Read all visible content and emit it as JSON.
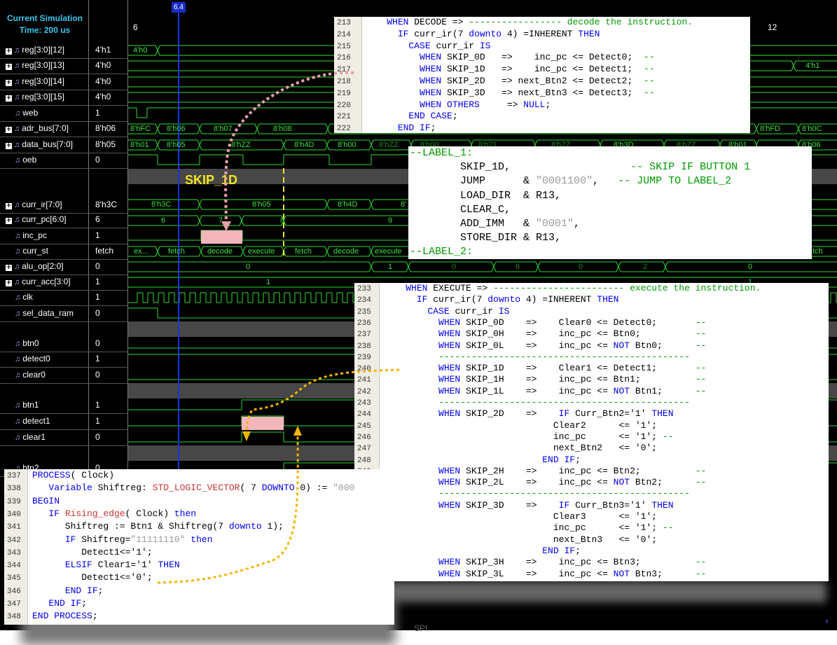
{
  "simulator": {
    "title_line1": "Current Simulation",
    "title_line2": "Time: 200 us",
    "cursor_time": "6.4",
    "ticks": [
      "6",
      "12"
    ],
    "annotation": "SKIP_1D",
    "bottom_text": "SPI"
  },
  "signals": [
    {
      "name": "reg[3:0][12]",
      "value": "4'h1"
    },
    {
      "name": "reg[3:0][13]",
      "value": "4'h0"
    },
    {
      "name": "reg[3:0][14]",
      "value": "4'h0"
    },
    {
      "name": "reg[3:0][15]",
      "value": "4'h0"
    },
    {
      "name": "web",
      "value": "1"
    },
    {
      "name": "adr_bus[7:0]",
      "value": "8'h06"
    },
    {
      "name": "data_bus[7:0]",
      "value": "8'h05"
    },
    {
      "name": "oeb",
      "value": "0"
    },
    {
      "name": "curr_ir[7:0]",
      "value": "8'h3C"
    },
    {
      "name": "curr_pc[6:0]",
      "value": "6"
    },
    {
      "name": "inc_pc",
      "value": "1"
    },
    {
      "name": "curr_st",
      "value": "fetch"
    },
    {
      "name": "alu_op[2:0]",
      "value": "0"
    },
    {
      "name": "curr_acc[3:0]",
      "value": "1"
    },
    {
      "name": "clk",
      "value": "1"
    },
    {
      "name": "sel_data_ram",
      "value": "0"
    },
    {
      "name": "btn0",
      "value": "0"
    },
    {
      "name": "detect0",
      "value": "1"
    },
    {
      "name": "clear0",
      "value": "0"
    },
    {
      "name": "btn1",
      "value": "1"
    },
    {
      "name": "detect1",
      "value": "1"
    },
    {
      "name": "clear1",
      "value": "0"
    },
    {
      "name": "btn2",
      "value": "0"
    }
  ],
  "wave_labels": {
    "reg12": [
      "4'h0"
    ],
    "reg13": [
      "4'h1"
    ],
    "adr": [
      "8'hFC",
      "8'h06",
      "8'h07",
      "8'h08",
      "8'hFD",
      "8'h0C"
    ],
    "data": [
      "8'h01",
      "8'h05",
      "8'hZZ",
      "8'h4D",
      "8'h00",
      "8'hZZ",
      "8'h00",
      "8'h21",
      "8'hZZ",
      "8'h3D",
      "8'hZZ",
      "8'h01",
      "8'h06"
    ],
    "ir": [
      "8'h3C",
      "8'h05",
      "8'h4D",
      "8'"
    ],
    "pc": [
      "6",
      "7",
      "8",
      "9"
    ],
    "st": [
      "ex...",
      "fetch",
      "decode",
      "execute",
      "fetch",
      "decode",
      "execute",
      "tch"
    ],
    "alu": [
      "0",
      "1",
      "0",
      "6",
      "0",
      "2",
      "0"
    ],
    "acc": [
      "1",
      "1"
    ]
  },
  "decode_panel": {
    "lines": [
      {
        "n": "213",
        "segs": [
          {
            "t": "    "
          },
          {
            "t": "WHEN",
            "c": "kw"
          },
          {
            "t": " DECODE => "
          },
          {
            "t": "----------------- decode the instruction.",
            "c": "cm"
          }
        ]
      },
      {
        "n": "214",
        "segs": [
          {
            "t": "      "
          },
          {
            "t": "IF",
            "c": "kw"
          },
          {
            "t": " curr_ir(7 "
          },
          {
            "t": "downto",
            "c": "kw"
          },
          {
            "t": " 4) =INHERENT "
          },
          {
            "t": "THEN",
            "c": "kw"
          }
        ]
      },
      {
        "n": "215",
        "segs": [
          {
            "t": "        "
          },
          {
            "t": "CASE",
            "c": "kw"
          },
          {
            "t": " curr_ir "
          },
          {
            "t": "IS",
            "c": "kw"
          }
        ]
      },
      {
        "n": "216",
        "segs": [
          {
            "t": "          "
          },
          {
            "t": "WHEN",
            "c": "kw"
          },
          {
            "t": " SKIP_0D   =>    inc_pc <= Detect0;  "
          },
          {
            "t": "--",
            "c": "cm"
          }
        ]
      },
      {
        "n": "217",
        "segs": [
          {
            "t": "          "
          },
          {
            "t": "WHEN",
            "c": "kw"
          },
          {
            "t": " SKIP_1D   =>    inc_pc <= Detect1;  "
          },
          {
            "t": "--",
            "c": "cm"
          }
        ]
      },
      {
        "n": "218",
        "segs": [
          {
            "t": "          "
          },
          {
            "t": "WHEN",
            "c": "kw"
          },
          {
            "t": " SKIP_2D   => next_Btn2 <= Detect2;  "
          },
          {
            "t": "--",
            "c": "cm"
          }
        ]
      },
      {
        "n": "219",
        "segs": [
          {
            "t": "          "
          },
          {
            "t": "WHEN",
            "c": "kw"
          },
          {
            "t": " SKIP_3D   => next_Btn3 <= Detect3;  "
          },
          {
            "t": "--",
            "c": "cm"
          }
        ]
      },
      {
        "n": "220",
        "segs": [
          {
            "t": "          "
          },
          {
            "t": "WHEN",
            "c": "kw"
          },
          {
            "t": " "
          },
          {
            "t": "OTHERS",
            "c": "kw"
          },
          {
            "t": "     => "
          },
          {
            "t": "NULL",
            "c": "kw"
          },
          {
            "t": ";"
          }
        ]
      },
      {
        "n": "221",
        "segs": [
          {
            "t": "        "
          },
          {
            "t": "END CASE",
            "c": "kw"
          },
          {
            "t": ";"
          }
        ]
      },
      {
        "n": "222",
        "segs": [
          {
            "t": "      "
          },
          {
            "t": "END IF",
            "c": "kw"
          },
          {
            "t": ";"
          }
        ]
      }
    ]
  },
  "label_panel": {
    "lines": [
      {
        "segs": [
          {
            "t": "--LABEL_1:",
            "c": "cm"
          }
        ]
      },
      {
        "segs": [
          {
            "t": "        SKIP_1D,                   "
          },
          {
            "t": "-- SKIP IF BUTTON 1",
            "c": "cm"
          }
        ]
      },
      {
        "segs": [
          {
            "t": "        JUMP      & "
          },
          {
            "t": "\"0001100\"",
            "c": "st"
          },
          {
            "t": ",   "
          },
          {
            "t": "-- JUMP TO LABEL_2",
            "c": "cm"
          }
        ]
      },
      {
        "segs": [
          {
            "t": "        LOAD_DIR  & R13,"
          }
        ]
      },
      {
        "segs": [
          {
            "t": "        CLEAR_C,"
          }
        ]
      },
      {
        "segs": [
          {
            "t": "        ADD_IMM   & "
          },
          {
            "t": "\"0001\"",
            "c": "st"
          },
          {
            "t": ","
          }
        ]
      },
      {
        "segs": [
          {
            "t": "        STORE_DIR & R13,"
          }
        ]
      },
      {
        "segs": [
          {
            "t": "--LABEL_2:",
            "c": "cm"
          }
        ]
      }
    ]
  },
  "execute_panel": {
    "lines": [
      {
        "n": "233",
        "segs": [
          {
            "t": "    "
          },
          {
            "t": "WHEN",
            "c": "kw"
          },
          {
            "t": " EXECUTE => "
          },
          {
            "t": "------------------------ execute the instruction.",
            "c": "cm"
          }
        ]
      },
      {
        "n": "234",
        "segs": [
          {
            "t": "      "
          },
          {
            "t": "IF",
            "c": "kw"
          },
          {
            "t": " curr_ir(7 "
          },
          {
            "t": "downto",
            "c": "kw"
          },
          {
            "t": " 4) =INHERENT "
          },
          {
            "t": "THEN",
            "c": "kw"
          }
        ]
      },
      {
        "n": "235",
        "segs": [
          {
            "t": "        "
          },
          {
            "t": "CASE",
            "c": "kw"
          },
          {
            "t": " curr_ir "
          },
          {
            "t": "IS",
            "c": "kw"
          }
        ]
      },
      {
        "n": "236",
        "segs": [
          {
            "t": "          "
          },
          {
            "t": "WHEN",
            "c": "kw"
          },
          {
            "t": " SKIP_0D    =>    Clear0 <= Detect0;       "
          },
          {
            "t": "--",
            "c": "cm"
          }
        ]
      },
      {
        "n": "237",
        "segs": [
          {
            "t": "          "
          },
          {
            "t": "WHEN",
            "c": "kw"
          },
          {
            "t": " SKIP_0H    =>    inc_pc <= Btn0;          "
          },
          {
            "t": "--",
            "c": "cm"
          }
        ]
      },
      {
        "n": "238",
        "segs": [
          {
            "t": "          "
          },
          {
            "t": "WHEN",
            "c": "kw"
          },
          {
            "t": " SKIP_0L    =>    inc_pc <= "
          },
          {
            "t": "NOT",
            "c": "kw"
          },
          {
            "t": " Btn0;      "
          },
          {
            "t": "--",
            "c": "cm"
          }
        ]
      },
      {
        "n": "239",
        "segs": [
          {
            "t": "          "
          },
          {
            "t": "----------------------------------------------",
            "c": "cm"
          }
        ]
      },
      {
        "n": "240",
        "segs": [
          {
            "t": "          "
          },
          {
            "t": "WHEN",
            "c": "kw"
          },
          {
            "t": " SKIP_1D    =>    Clear1 <= Detect1;       "
          },
          {
            "t": "--",
            "c": "cm"
          }
        ]
      },
      {
        "n": "241",
        "segs": [
          {
            "t": "          "
          },
          {
            "t": "WHEN",
            "c": "kw"
          },
          {
            "t": " SKIP_1H    =>    inc_pc <= Btn1;          "
          },
          {
            "t": "--",
            "c": "cm"
          }
        ]
      },
      {
        "n": "242",
        "segs": [
          {
            "t": "          "
          },
          {
            "t": "WHEN",
            "c": "kw"
          },
          {
            "t": " SKIP_1L    =>    inc_pc <= "
          },
          {
            "t": "NOT",
            "c": "kw"
          },
          {
            "t": " Btn1;      "
          },
          {
            "t": "--",
            "c": "cm"
          }
        ]
      },
      {
        "n": "243",
        "segs": [
          {
            "t": "          "
          },
          {
            "t": "----------------------------------------------",
            "c": "cm"
          }
        ]
      },
      {
        "n": "244",
        "segs": [
          {
            "t": "          "
          },
          {
            "t": "WHEN",
            "c": "kw"
          },
          {
            "t": " SKIP_2D    =>    "
          },
          {
            "t": "IF",
            "c": "kw"
          },
          {
            "t": " Curr_Btn2='1' "
          },
          {
            "t": "THEN",
            "c": "kw"
          }
        ]
      },
      {
        "n": "245",
        "segs": [
          {
            "t": "                               Clear2      <= '1';"
          }
        ]
      },
      {
        "n": "246",
        "segs": [
          {
            "t": "                               inc_pc      <= '1'; "
          },
          {
            "t": "--",
            "c": "cm"
          }
        ]
      },
      {
        "n": "247",
        "segs": [
          {
            "t": "                               next_Btn2   <= '0';"
          }
        ]
      },
      {
        "n": "248",
        "segs": [
          {
            "t": "                             "
          },
          {
            "t": "END IF",
            "c": "kw"
          },
          {
            "t": ";"
          }
        ]
      },
      {
        "n": "249",
        "segs": [
          {
            "t": "          "
          },
          {
            "t": "WHEN",
            "c": "kw"
          },
          {
            "t": " SKIP_2H    =>    inc_pc <= Btn2;          "
          },
          {
            "t": "--",
            "c": "cm"
          }
        ]
      },
      {
        "n": "250",
        "segs": [
          {
            "t": "          "
          },
          {
            "t": "WHEN",
            "c": "kw"
          },
          {
            "t": " SKIP_2L    =>    inc_pc <= "
          },
          {
            "t": "NOT",
            "c": "kw"
          },
          {
            "t": " Btn2;      "
          },
          {
            "t": "--",
            "c": "cm"
          }
        ]
      },
      {
        "n": "251",
        "segs": [
          {
            "t": "          "
          },
          {
            "t": "----------------------------------------------",
            "c": "cm"
          }
        ]
      },
      {
        "n": "252",
        "segs": [
          {
            "t": "          "
          },
          {
            "t": "WHEN",
            "c": "kw"
          },
          {
            "t": " SKIP_3D    =>    "
          },
          {
            "t": "IF",
            "c": "kw"
          },
          {
            "t": " Curr_Btn3='1' "
          },
          {
            "t": "THEN",
            "c": "kw"
          }
        ]
      },
      {
        "n": "253",
        "segs": [
          {
            "t": "                               Clear3      <= '1';"
          }
        ]
      },
      {
        "n": "254",
        "segs": [
          {
            "t": "                               inc_pc      <= '1'; "
          },
          {
            "t": "--",
            "c": "cm"
          }
        ]
      },
      {
        "n": "255",
        "segs": [
          {
            "t": "                               next_Btn3   <= '0';"
          }
        ]
      },
      {
        "n": "256",
        "segs": [
          {
            "t": "                             "
          },
          {
            "t": "END IF",
            "c": "kw"
          },
          {
            "t": ";"
          }
        ]
      },
      {
        "n": "257",
        "segs": [
          {
            "t": "          "
          },
          {
            "t": "WHEN",
            "c": "kw"
          },
          {
            "t": " SKIP_3H    =>    inc_pc <= Btn3;          "
          },
          {
            "t": "--",
            "c": "cm"
          }
        ]
      },
      {
        "n": "258",
        "segs": [
          {
            "t": "          "
          },
          {
            "t": "WHEN",
            "c": "kw"
          },
          {
            "t": " SKIP_3L    =>    inc_pc <= "
          },
          {
            "t": "NOT",
            "c": "kw"
          },
          {
            "t": " Btn3;      "
          },
          {
            "t": "--",
            "c": "cm"
          }
        ]
      }
    ]
  },
  "process_panel": {
    "lines": [
      {
        "n": "337",
        "segs": [
          {
            "t": "PROCESS",
            "c": "kw"
          },
          {
            "t": "( Clock)"
          }
        ]
      },
      {
        "n": "338",
        "segs": [
          {
            "t": "   "
          },
          {
            "t": "Variable",
            "c": "kw"
          },
          {
            "t": " Shiftreg: "
          },
          {
            "t": "STD_LOGIC_VECTOR",
            "c": "ty"
          },
          {
            "t": "( 7 "
          },
          {
            "t": "DOWNTO",
            "c": "kw"
          },
          {
            "t": " 0) := "
          },
          {
            "t": "\"000",
            "c": "st"
          }
        ]
      },
      {
        "n": "339",
        "segs": [
          {
            "t": "BEGIN",
            "c": "kw"
          }
        ]
      },
      {
        "n": "340",
        "segs": [
          {
            "t": "   "
          },
          {
            "t": "IF",
            "c": "kw"
          },
          {
            "t": " "
          },
          {
            "t": "Rising_edge",
            "c": "ty"
          },
          {
            "t": "( Clock) "
          },
          {
            "t": "then",
            "c": "kw"
          }
        ]
      },
      {
        "n": "341",
        "segs": [
          {
            "t": "      Shiftreg := Btn1 & Shiftreg(7 "
          },
          {
            "t": "downto",
            "c": "kw"
          },
          {
            "t": " 1);"
          }
        ]
      },
      {
        "n": "342",
        "segs": [
          {
            "t": "      "
          },
          {
            "t": "IF",
            "c": "kw"
          },
          {
            "t": " Shiftreg="
          },
          {
            "t": "\"11111110\"",
            "c": "st"
          },
          {
            "t": " "
          },
          {
            "t": "then",
            "c": "kw"
          }
        ]
      },
      {
        "n": "343",
        "segs": [
          {
            "t": "         Detect1<='1';"
          }
        ]
      },
      {
        "n": "344",
        "segs": [
          {
            "t": "      "
          },
          {
            "t": "ELSIF",
            "c": "kw"
          },
          {
            "t": " Clear1='1' "
          },
          {
            "t": "THEN",
            "c": "kw"
          }
        ]
      },
      {
        "n": "345",
        "segs": [
          {
            "t": "         Detect1<='0';"
          }
        ]
      },
      {
        "n": "346",
        "segs": [
          {
            "t": "      "
          },
          {
            "t": "END IF",
            "c": "kw"
          },
          {
            "t": ";"
          }
        ]
      },
      {
        "n": "347",
        "segs": [
          {
            "t": "   "
          },
          {
            "t": "END IF",
            "c": "kw"
          },
          {
            "t": ";"
          }
        ]
      },
      {
        "n": "348",
        "segs": [
          {
            "t": "END PROCESS",
            "c": "kw"
          },
          {
            "t": ";"
          }
        ]
      }
    ]
  },
  "colors": {
    "wave": "#2edc2e",
    "highlight": "#f4b6bc",
    "cursor": "#1a34e0",
    "arrow_pink": "#e8a0a8",
    "arrow_orange": "#f5b400",
    "title_text": "#37c7ee"
  }
}
